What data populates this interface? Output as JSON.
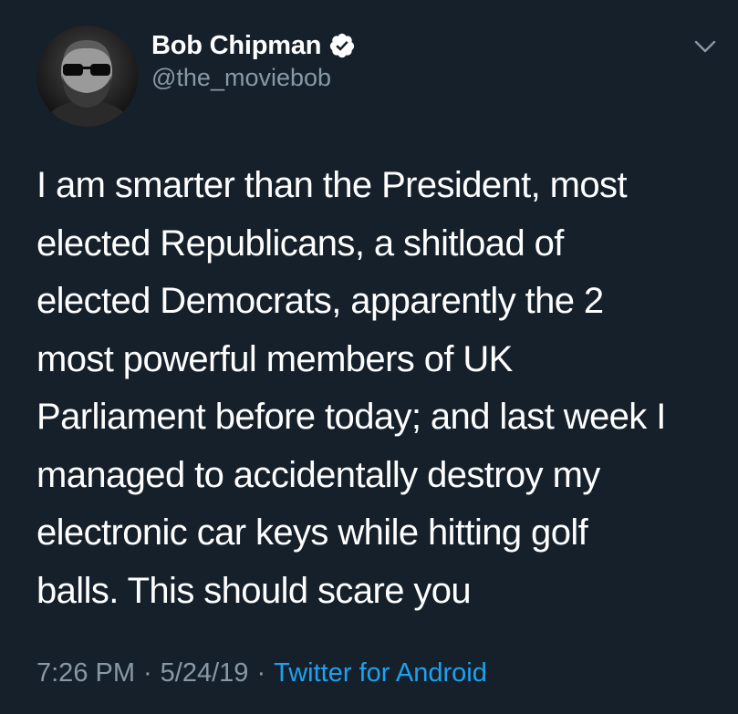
{
  "tweet": {
    "author": {
      "display_name": "Bob Chipman",
      "handle": "@the_moviebob",
      "verified": true,
      "avatar_icon": "avatar-photo"
    },
    "menu_icon": "chevron-down-icon",
    "text_lines": [
      "I am smarter than the President, most",
      "elected Republicans, a shitload of",
      "elected Democrats, apparently the 2",
      "most powerful members of UK",
      "Parliament before today; and last week I",
      "managed to accidentally destroy my",
      "electronic car keys while hitting golf",
      "balls. This should scare you"
    ],
    "time": "7:26 PM",
    "separator": "·",
    "date": "5/24/19",
    "source": "Twitter for Android"
  },
  "colors": {
    "background": "#15202b",
    "text": "#ffffff",
    "secondary_text": "#8899a6",
    "accent": "#1da1f2"
  }
}
